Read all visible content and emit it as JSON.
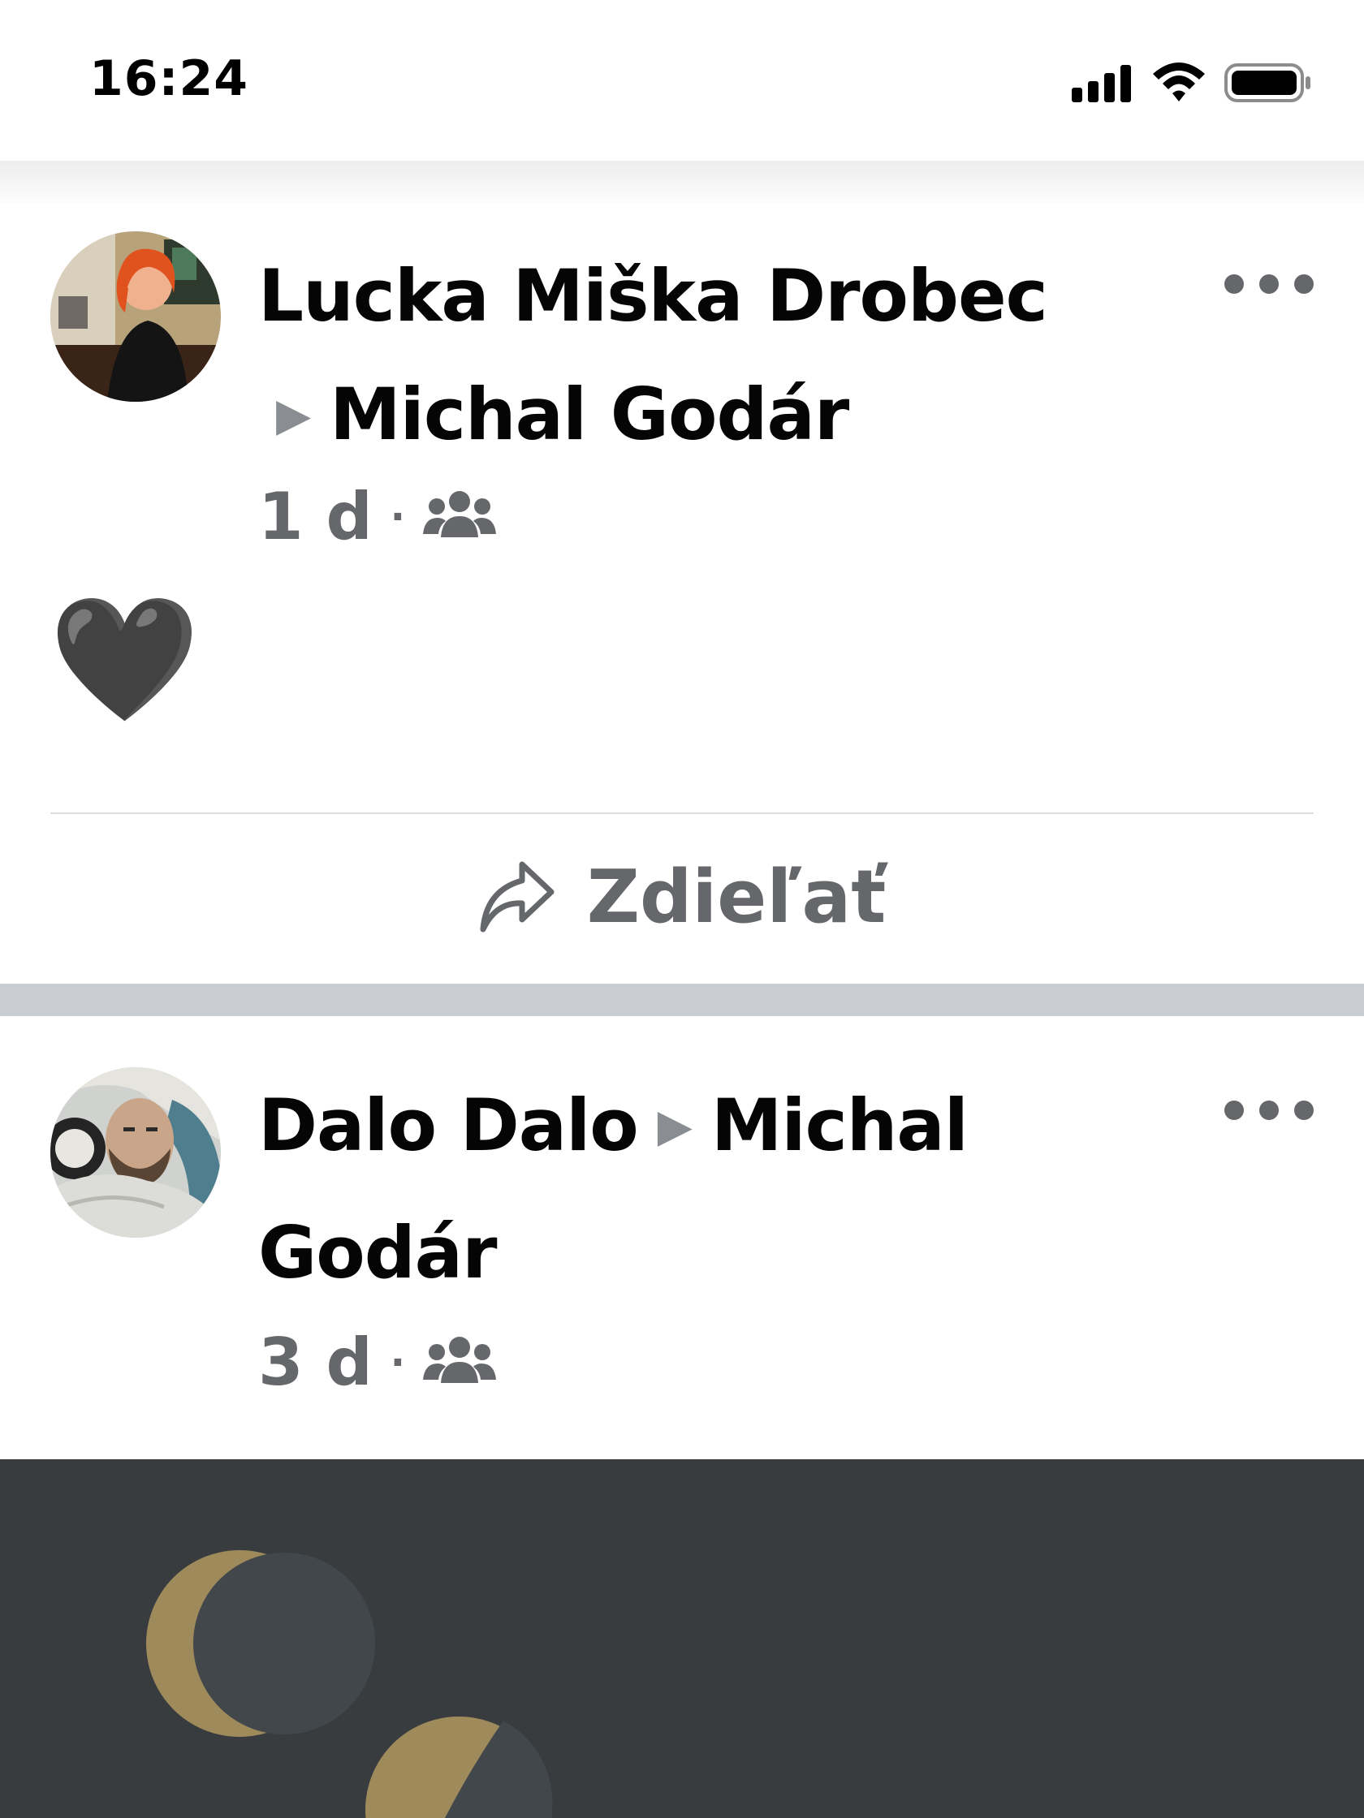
{
  "status_bar": {
    "time": "16:24",
    "icons": [
      "signal-icon",
      "wifi-icon",
      "battery-icon"
    ]
  },
  "posts": [
    {
      "author": "Lucka Miška Drobec",
      "target": "Michal Godár",
      "time": "1 d",
      "audience_icon": "group-icon",
      "body": "🖤",
      "actions": {
        "share_label": "Zdieľať"
      }
    },
    {
      "author": "Dalo Dalo",
      "target": "Michal Godár",
      "time": "3 d",
      "audience_icon": "group-icon"
    }
  ],
  "separator_arrow": "▶",
  "meta_dot": "·",
  "colors": {
    "text_primary": "#050505",
    "text_secondary": "#65676b",
    "arrow": "#8a8d91",
    "separator": "#c9ccd1",
    "media_bg": "#393c3f",
    "media_accent": "#9f8a5c"
  }
}
